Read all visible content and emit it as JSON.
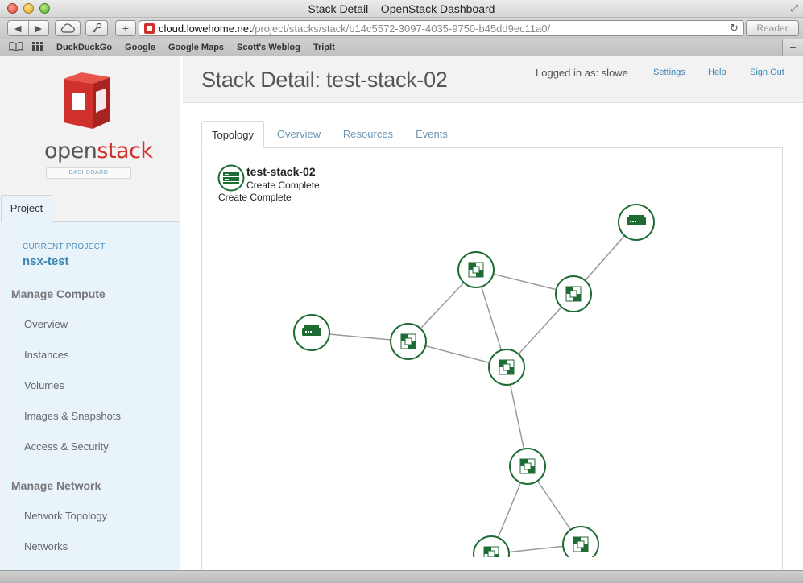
{
  "window": {
    "title": "Stack Detail – OpenStack Dashboard"
  },
  "toolbar": {
    "back_icon": "◀",
    "forward_icon": "▶",
    "plus_icon": "+",
    "url_host": "cloud.lowehome.net",
    "url_path": "/project/stacks/stack/b14c5572-3097-4035-9750-b45dd9ec11a0/",
    "reader_label": "Reader",
    "reload_icon": "↻"
  },
  "bookmarks": {
    "items": [
      "DuckDuckGo",
      "Google",
      "Google Maps",
      "Scott's Weblog",
      "TripIt"
    ]
  },
  "sidebar": {
    "logo_text_open": "open",
    "logo_text_stack": "stack",
    "logo_sub": "DASHBOARD",
    "tab_label": "Project",
    "current_project_label": "CURRENT PROJECT",
    "current_project_name": "nsx-test",
    "sections": [
      {
        "heading": "Manage Compute",
        "items": [
          "Overview",
          "Instances",
          "Volumes",
          "Images & Snapshots",
          "Access & Security"
        ]
      },
      {
        "heading": "Manage Network",
        "items": [
          "Network Topology",
          "Networks"
        ]
      }
    ]
  },
  "header": {
    "title": "Stack Detail: test-stack-02",
    "logged_in": "Logged in as: slowe",
    "links": [
      "Settings",
      "Help",
      "Sign Out"
    ]
  },
  "tabs": [
    "Topology",
    "Overview",
    "Resources",
    "Events"
  ],
  "stack": {
    "name": "test-stack-02",
    "status_line_1": "Create Complete",
    "status_line_2": "Create Complete"
  },
  "topology": {
    "nodes": [
      {
        "id": "server-1",
        "kind": "server-icon"
      },
      {
        "id": "net-a",
        "kind": "network-icon"
      },
      {
        "id": "net-b",
        "kind": "network-icon"
      },
      {
        "id": "server-2",
        "kind": "server-icon"
      },
      {
        "id": "net-c",
        "kind": "network-icon"
      },
      {
        "id": "net-d",
        "kind": "network-icon"
      },
      {
        "id": "net-e",
        "kind": "network-icon"
      },
      {
        "id": "net-f",
        "kind": "network-icon"
      },
      {
        "id": "net-g",
        "kind": "network-icon"
      }
    ],
    "edges": [
      [
        "server-1",
        "net-b"
      ],
      [
        "net-a",
        "net-b"
      ],
      [
        "net-a",
        "net-c"
      ],
      [
        "net-a",
        "net-e"
      ],
      [
        "net-c",
        "net-e"
      ],
      [
        "net-b",
        "net-e"
      ],
      [
        "server-2",
        "net-c"
      ],
      [
        "net-e",
        "net-f"
      ],
      [
        "net-f",
        "net-g"
      ],
      [
        "net-f",
        "net-h"
      ],
      [
        "net-g",
        "net-h"
      ]
    ]
  },
  "colors": {
    "accent_green": "#1e6b34",
    "link_blue": "#3a86b4",
    "openstack_red": "#d0312d"
  }
}
